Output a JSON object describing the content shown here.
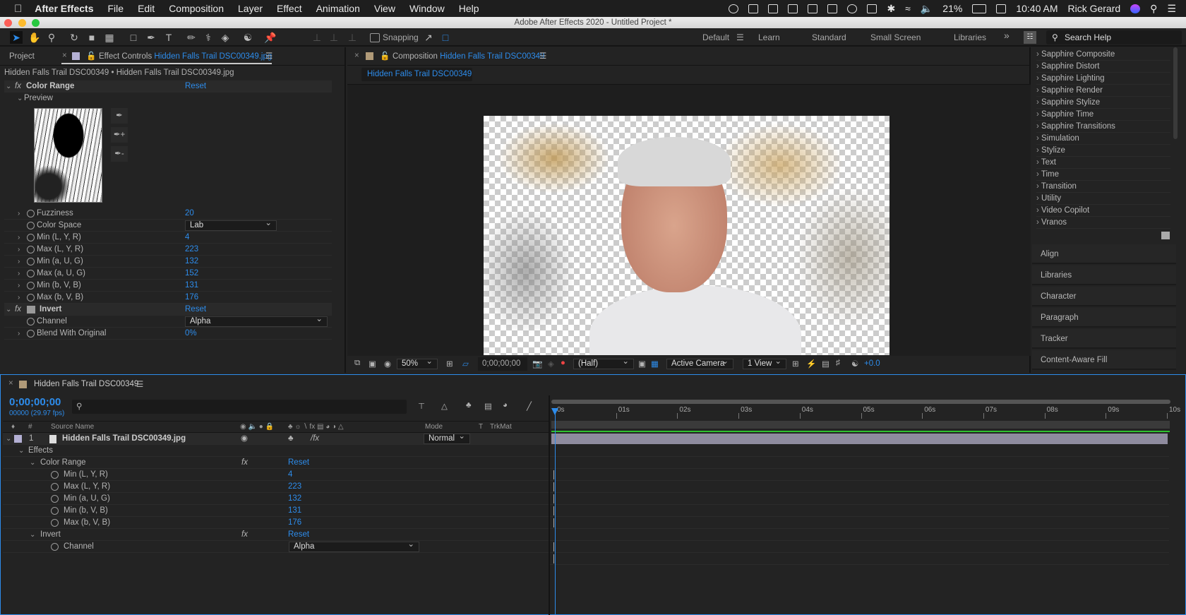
{
  "menubar": {
    "app": "After Effects",
    "items": [
      "File",
      "Edit",
      "Composition",
      "Layer",
      "Effect",
      "Animation",
      "View",
      "Window",
      "Help"
    ],
    "battery": "21%",
    "time": "10:40 AM",
    "user": "Rick Gerard"
  },
  "window": {
    "title": "Adobe After Effects 2020 - Untitled Project *"
  },
  "toolbar": {
    "snapping": "Snapping",
    "workspaces": [
      "Default",
      "Learn",
      "Standard",
      "Small Screen",
      "Libraries"
    ],
    "search_placeholder": "Search Help"
  },
  "left_panel": {
    "tab_project": "Project",
    "tab_effect_controls": "Effect Controls",
    "effect_source": "Hidden Falls Trail DSC00349.jpg",
    "breadcrumb": "Hidden Falls Trail DSC00349 • Hidden Falls Trail DSC00349.jpg",
    "color_range": {
      "name": "Color Range",
      "reset": "Reset",
      "preview": "Preview",
      "params": [
        {
          "label": "Fuzziness",
          "value": "20"
        },
        {
          "label": "Color Space",
          "value": "Lab"
        },
        {
          "label": "Min (L, Y, R)",
          "value": "4"
        },
        {
          "label": "Max (L, Y, R)",
          "value": "223"
        },
        {
          "label": "Min (a, U, G)",
          "value": "132"
        },
        {
          "label": "Max (a, U, G)",
          "value": "152"
        },
        {
          "label": "Min (b, V, B)",
          "value": "131"
        },
        {
          "label": "Max (b, V, B)",
          "value": "176"
        }
      ]
    },
    "invert": {
      "name": "Invert",
      "reset": "Reset",
      "params": [
        {
          "label": "Channel",
          "value": "Alpha"
        },
        {
          "label": "Blend With Original",
          "value": "0%"
        }
      ]
    }
  },
  "comp_panel": {
    "tab_label": "Composition",
    "comp_name": "Hidden Falls Trail DSC00349",
    "subtab": "Hidden Falls Trail DSC00349",
    "viewer_bar": {
      "zoom": "50%",
      "timecode": "0;00;00;00",
      "resolution": "(Half)",
      "camera": "Active Camera",
      "views": "1 View",
      "exposure": "+0.0"
    }
  },
  "right_panel": {
    "effects": [
      "Sapphire Composite",
      "Sapphire Distort",
      "Sapphire Lighting",
      "Sapphire Render",
      "Sapphire Stylize",
      "Sapphire Time",
      "Sapphire Transitions",
      "Simulation",
      "Stylize",
      "Text",
      "Time",
      "Transition",
      "Utility",
      "Video Copilot",
      "Vranos"
    ],
    "panels": [
      "Align",
      "Libraries",
      "Character",
      "Paragraph",
      "Tracker",
      "Content-Aware Fill"
    ]
  },
  "timeline": {
    "tab": "Hidden Falls Trail DSC00349",
    "timecode": "0;00;00;00",
    "frames": "00000 (29.97 fps)",
    "columns": {
      "num": "#",
      "source": "Source Name",
      "mode": "Mode",
      "t": "T",
      "trkmat": "TrkMat"
    },
    "layer": {
      "num": "1",
      "name": "Hidden Falls Trail DSC00349.jpg",
      "mode": "Normal"
    },
    "effects_label": "Effects",
    "color_range": {
      "name": "Color Range",
      "reset": "Reset",
      "params": [
        {
          "label": "Min (L, Y, R)",
          "value": "4"
        },
        {
          "label": "Max (L, Y, R)",
          "value": "223"
        },
        {
          "label": "Min (a, U, G)",
          "value": "132"
        },
        {
          "label": "Min (b, V, B)",
          "value": "131"
        },
        {
          "label": "Max (b, V, B)",
          "value": "176"
        }
      ]
    },
    "invert": {
      "name": "Invert",
      "reset": "Reset",
      "channel_label": "Channel",
      "channel_value": "Alpha"
    },
    "ruler": [
      "0s",
      "01s",
      "02s",
      "03s",
      "04s",
      "05s",
      "06s",
      "07s",
      "08s",
      "09s",
      "10s"
    ]
  },
  "colors": {
    "accent": "#2d8ceb",
    "layer_label": "#b4b0d4",
    "comp_label": "#b09a78",
    "workarea": "#2ec22e"
  }
}
